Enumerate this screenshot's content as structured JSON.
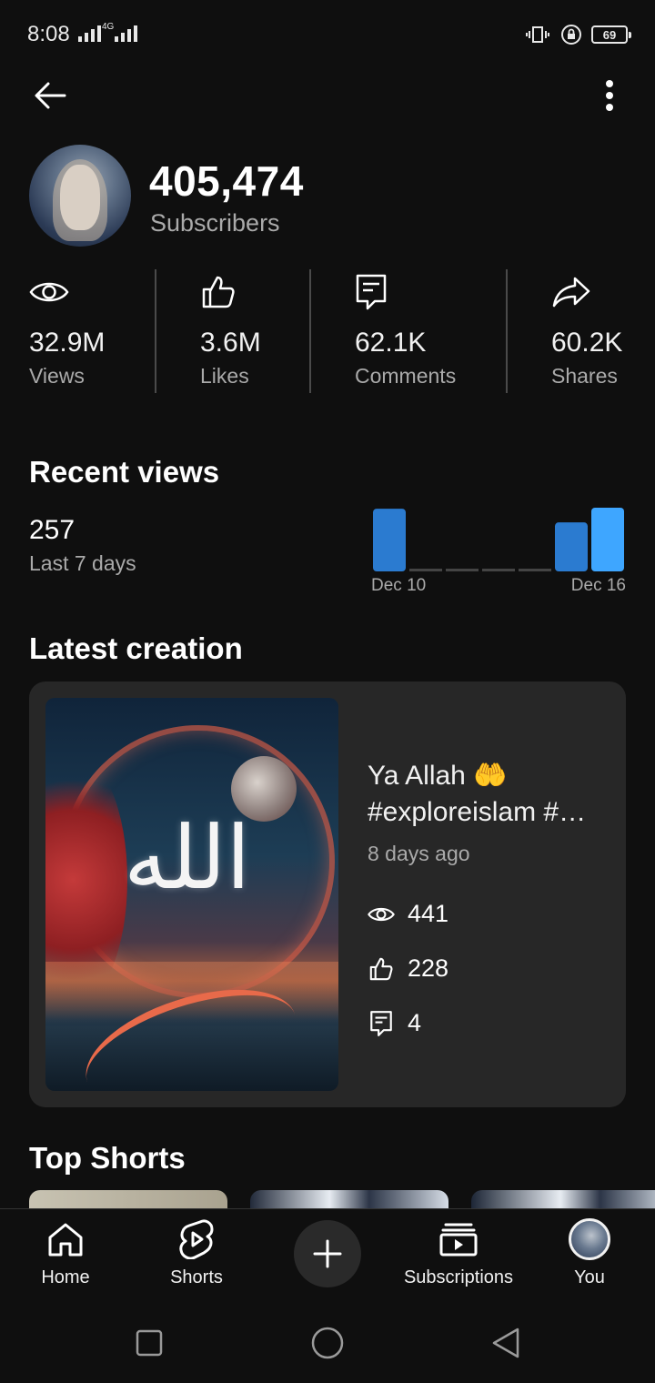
{
  "status_bar": {
    "time": "8:08",
    "network": "4G",
    "battery": "69"
  },
  "header": {
    "back_icon": "arrow-left-icon",
    "menu_icon": "more-vertical-icon"
  },
  "channel": {
    "subscribers_value": "405,474",
    "subscribers_label": "Subscribers"
  },
  "stats": [
    {
      "value": "32.9M",
      "label": "Views",
      "icon": "eye-icon"
    },
    {
      "value": "3.6M",
      "label": "Likes",
      "icon": "thumbs-up-icon"
    },
    {
      "value": "62.1K",
      "label": "Comments",
      "icon": "comment-icon"
    },
    {
      "value": "60.2K",
      "label": "Shares",
      "icon": "share-icon"
    }
  ],
  "recent_views": {
    "heading": "Recent views",
    "value": "257",
    "period": "Last 7 days",
    "x_start_label": "Dec 10",
    "x_end_label": "Dec 16"
  },
  "chart_data": {
    "type": "bar",
    "categories": [
      "Dec 10",
      "Dec 11",
      "Dec 12",
      "Dec 13",
      "Dec 14",
      "Dec 15",
      "Dec 16"
    ],
    "values": [
      64,
      0,
      0,
      0,
      0,
      50,
      65
    ],
    "highlight_index": 6,
    "colors": {
      "bar": "#2b7bd0",
      "highlight": "#3ea6ff",
      "empty": "#444444"
    },
    "grid": false
  },
  "latest_creation": {
    "heading": "Latest creation",
    "title_line1": "Ya Allah 🤲",
    "title_line2": "#exploreislam #…",
    "age": "8 days ago",
    "views": "441",
    "likes": "228",
    "comments": "4",
    "thumbnail_text": "الله"
  },
  "top_shorts": {
    "heading": "Top Shorts"
  },
  "bottom_nav": {
    "home": "Home",
    "shorts": "Shorts",
    "subscriptions": "Subscriptions",
    "you": "You"
  }
}
